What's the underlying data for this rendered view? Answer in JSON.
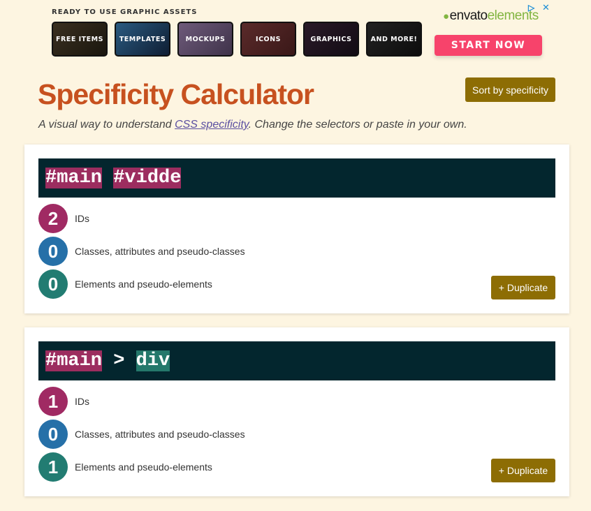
{
  "ad": {
    "label": "READY TO USE GRAPHIC ASSETS",
    "tiles": [
      {
        "label": "FREE ITEMS",
        "color": "#2a2418"
      },
      {
        "label": "TEMPLATES",
        "color": "#1d3b5a"
      },
      {
        "label": "MOCKUPS",
        "color": "#5b4a66"
      },
      {
        "label": "ICONS",
        "color": "#4a2222"
      },
      {
        "label": "GRAPHICS",
        "color": "#1c1420"
      },
      {
        "label": "AND MORE!",
        "color": "#151515"
      }
    ],
    "brand_main": "envato",
    "brand_sub": "elements",
    "cta": "START NOW",
    "choices_icon": "adchoices-icon",
    "close_icon": "close-icon"
  },
  "header": {
    "title": "Specificity Calculator",
    "subtitle_before": "A visual way to understand ",
    "subtitle_link": "CSS specificity",
    "subtitle_after": ". Change the selectors or paste in your own.",
    "sort_label": "Sort by specificity"
  },
  "labels": {
    "ids": "IDs",
    "classes": "Classes, attributes and pseudo-classes",
    "elements": "Elements and pseudo-elements",
    "duplicate": "+ Duplicate"
  },
  "selectors": [
    {
      "tokens": [
        {
          "text": "#main",
          "type": "id"
        },
        {
          "text": " ",
          "type": "comb"
        },
        {
          "text": "#vidde",
          "type": "id"
        }
      ],
      "ids": "2",
      "classes": "0",
      "elements": "0"
    },
    {
      "tokens": [
        {
          "text": "#main",
          "type": "id"
        },
        {
          "text": " > ",
          "type": "comb"
        },
        {
          "text": "div",
          "type": "el"
        }
      ],
      "ids": "1",
      "classes": "0",
      "elements": "1"
    }
  ],
  "colors": {
    "title": "#c7511f",
    "button": "#8d6d04",
    "id": "#a02a63",
    "class": "#2670a8",
    "element": "#227c72",
    "bar": "#03262e"
  }
}
